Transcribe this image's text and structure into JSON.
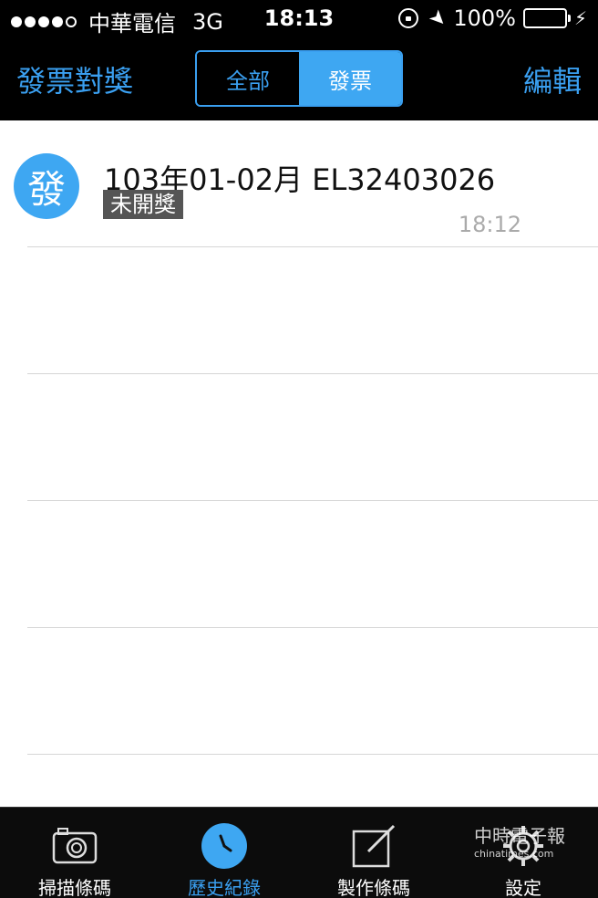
{
  "status_bar": {
    "carrier": "中華電信",
    "network": "3G",
    "time": "18:13",
    "battery": "100%",
    "battery_level": 1.0
  },
  "nav": {
    "title": "發票對獎",
    "segments": [
      "全部",
      "發票"
    ],
    "active_segment": "發票",
    "edit_label": "編輯"
  },
  "list": {
    "items": [
      {
        "avatar_text": "發",
        "title": "103年01-02月 EL32403026",
        "badge": "未開獎",
        "time": "18:12"
      }
    ]
  },
  "tabs": [
    {
      "label": "掃描條碼",
      "icon": "camera-icon"
    },
    {
      "label": "歷史紀錄",
      "icon": "clock-icon"
    },
    {
      "label": "製作條碼",
      "icon": "edit-icon"
    },
    {
      "label": "設定",
      "icon": "gear-icon"
    }
  ],
  "active_tab": "歷史紀錄",
  "watermark": {
    "text": "中時電子報",
    "sub": "chinatimes.com"
  },
  "colors": {
    "accent": "#3a9ff0",
    "active_segment_bg": "#3ea7f2",
    "battery": "#4cd964",
    "badge_bg": "#555555"
  }
}
